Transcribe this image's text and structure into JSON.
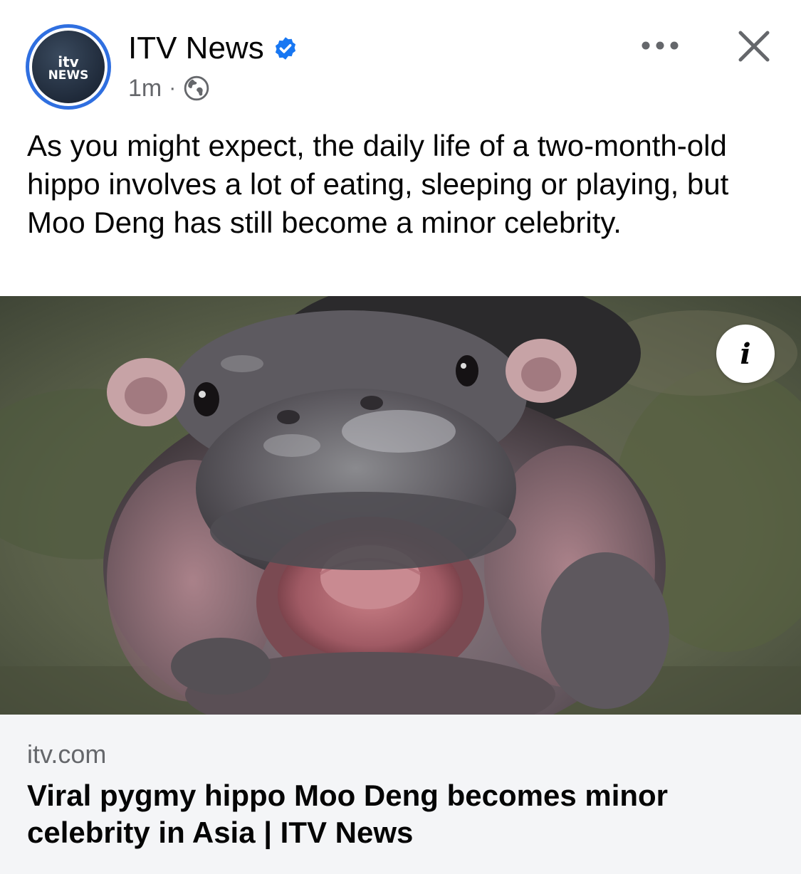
{
  "header": {
    "page_name": "ITV News",
    "timestamp": "1m",
    "separator": "·",
    "avatar": {
      "logo_top": "itv",
      "logo_bottom": "NEWS"
    },
    "verified_icon": "verified-badge-icon",
    "audience_icon": "globe-icon",
    "more_icon": "more-horizontal-icon",
    "close_icon": "close-icon"
  },
  "post": {
    "caption": "As you might expect, the daily life of a two-month-old hippo involves a lot of eating, sleeping or playing, but Moo Deng has still become a minor celebrity."
  },
  "link_preview": {
    "image_alt": "photo",
    "info_icon": "info-icon",
    "info_glyph": "i",
    "domain": "itv.com",
    "title": "Viral pygmy hippo Moo Deng becomes minor celebrity in Asia | ITV News"
  },
  "colors": {
    "verified_blue": "#1877f2",
    "avatar_ring": "#2f6fe0",
    "secondary_text": "#65676b",
    "link_footer_bg": "#f4f5f7"
  }
}
